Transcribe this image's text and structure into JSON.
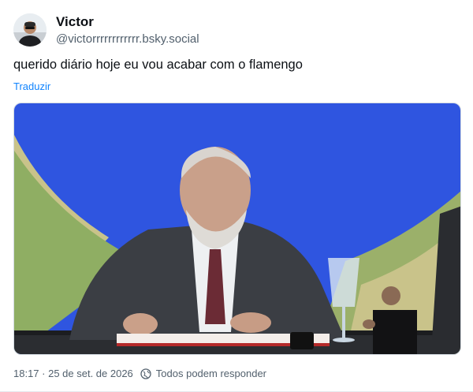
{
  "author": {
    "display_name": "Victor",
    "handle": "@victorrrrrrrrrrrr.bsky.social"
  },
  "post": {
    "text": "querido diário hoje eu vou acabar com o flamengo",
    "translate_label": "Traduzir"
  },
  "meta": {
    "timestamp": "18:17 · 25 de set. de 2026",
    "reply_setting": "Todos podem responder"
  },
  "colors": {
    "link": "#1083fe",
    "secondary_text": "#52606d",
    "backdrop_blue": "#2f55e0"
  },
  "icons": {
    "reply_setting": "globe-icon"
  }
}
